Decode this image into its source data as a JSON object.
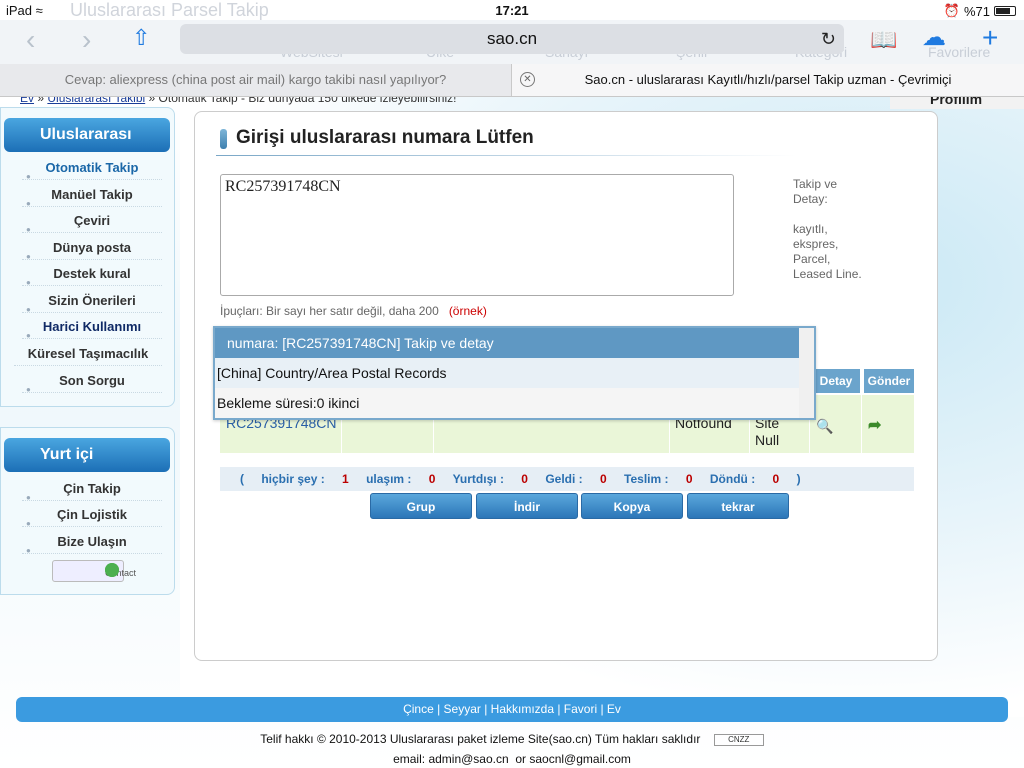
{
  "status_bar": {
    "device": "iPad",
    "time": "17:21",
    "battery": "%71"
  },
  "browser": {
    "url": "sao.cn",
    "tabs": [
      {
        "title": "Cevap: aliexpress (china post air mail) kargo takibi nasıl yapılıyor?",
        "active": false
      },
      {
        "title": "Sao.cn - uluslararası Kayıtlı/hızlı/parsel Takip uzman - Çevrimiçi",
        "active": true
      }
    ],
    "toolbar_ghost": [
      "Uluslararası Parsel Takip",
      "WebSitesi",
      "Ülke",
      "Sanayi",
      "Şehir",
      "Kategori",
      "Favorilere"
    ]
  },
  "breadcrumb": {
    "home": "Ev",
    "section": "Uluslararası Takibi",
    "rest": "» Otomatik Takip - Biz dünyada 150 ülkede izleyebilirsiniz!"
  },
  "profile_label": "Profilim",
  "sidebar": {
    "international_title": "Uluslararası",
    "international_items": [
      "Otomatik Takip",
      "Manüel Takip",
      "Çeviri",
      "Dünya posta",
      "Destek kural",
      "Sizin Önerileri",
      "Harici Kullanımı",
      "Küresel Taşımacılık",
      "Son Sorgu"
    ],
    "domestic_title": "Yurt içi",
    "domestic_items": [
      "Çin Takip",
      "Çin Lojistik",
      "Bize Ulaşın"
    ],
    "contact_badge": "Contact"
  },
  "main": {
    "title": "Girişi uluslararası numara Lütfen",
    "tracking_input": "RC257391748CN",
    "hint": "İpuçları: Bir sayı her satır değil, daha 200",
    "hint_example": "(örnek)",
    "side_help": [
      "Takip ve",
      "Detay:",
      "",
      "kayıtlı,",
      "ekspres,",
      "Parcel,",
      "Leased Line."
    ]
  },
  "dropdown": {
    "header": "numara:  [RC257391748CN] Takip ve detay",
    "row1": "[China]  Country/Area Postal Records",
    "row2": "Bekleme süresi:0 ikinci"
  },
  "table": {
    "headers": {
      "detail": "Detay",
      "send": "Gönder"
    },
    "row": {
      "number": "RC257391748CN",
      "status": "Notfound",
      "site": "Site",
      "null": "Null"
    }
  },
  "counts": {
    "open": "(",
    "none_label": "hiçbir şey :",
    "none": "1",
    "reached_label": "ulaşım :",
    "reached": "0",
    "abroad_label": "Yurtdışı :",
    "abroad": "0",
    "arrived_label": "Geldi :",
    "arrived": "0",
    "delivered_label": "Teslim :",
    "delivered": "0",
    "returned_label": "Döndü :",
    "returned": "0",
    "close": ")"
  },
  "buttons": [
    "Grup",
    "İndir",
    "Kopya",
    "tekrar"
  ],
  "footer": {
    "links": "Çince | Seyyar | Hakkımızda | Favori | Ev",
    "copyright": "Telif hakkı © 2010-2013 Uluslararası paket izleme Site(sao.cn)   Tüm hakları saklıdır",
    "cnzz": "CNZZ",
    "email_label": "email:",
    "email1": "admin@sao.cn",
    "or": "or",
    "email2": "saocnl@gmail.com"
  },
  "colors": {
    "accent": "#2c76b8",
    "sidebar_head": "#1c6fb6",
    "count_number": "#b00"
  }
}
